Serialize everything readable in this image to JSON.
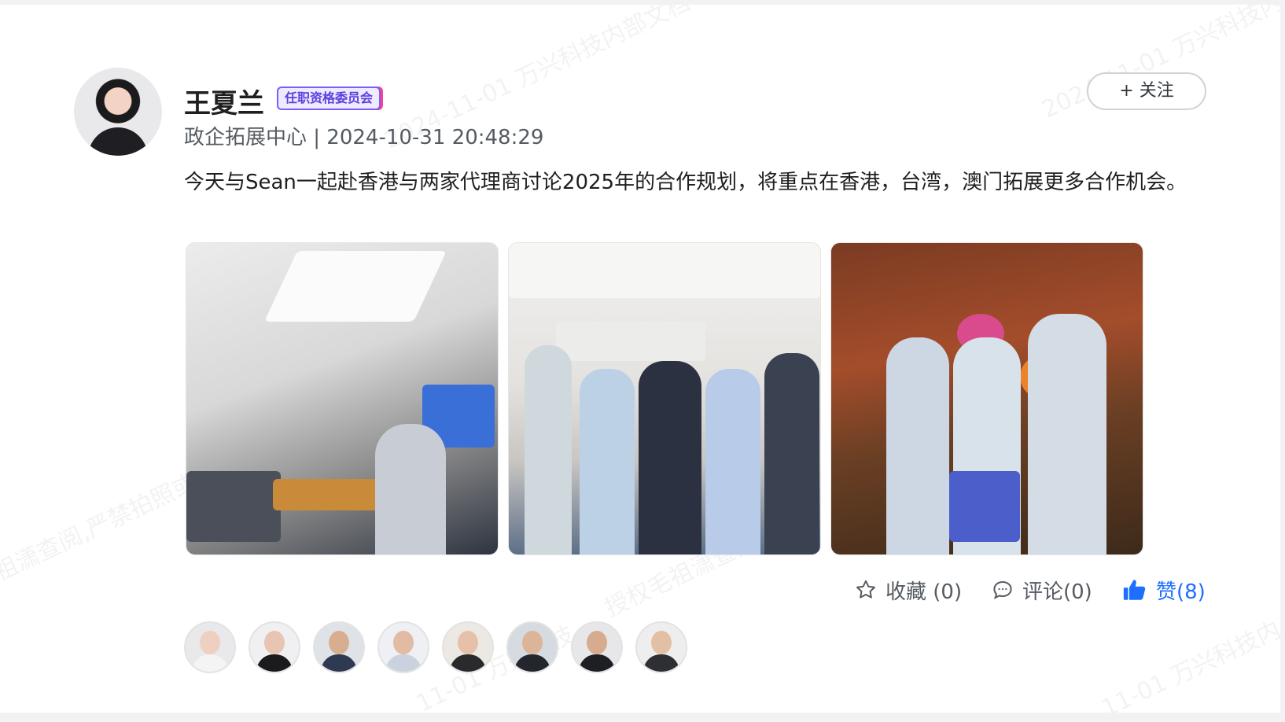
{
  "post": {
    "author_name": "王夏兰",
    "badge": "任职资格委员会",
    "meta": "政企拓展中心 | 2024-10-31 20:48:29",
    "follow_label": "+ 关注",
    "content": "今天与Sean一起赴香港与两家代理商讨论2025年的合作规划，将重点在香港，台湾，澳门拓展更多合作机会。"
  },
  "actions": {
    "favorite": {
      "label": "收藏 (0)",
      "icon": "star-icon"
    },
    "comment": {
      "label": "评论(0)",
      "icon": "comment-icon"
    },
    "like": {
      "label": "赞(8)",
      "icon": "thumbs-up-icon",
      "active": true
    }
  },
  "photos": [
    {
      "name": "meeting-room-photo"
    },
    {
      "name": "office-group-photo"
    },
    {
      "name": "flower-wall-photo"
    }
  ],
  "likers": [
    {
      "name": "liker-1"
    },
    {
      "name": "liker-2"
    },
    {
      "name": "liker-3"
    },
    {
      "name": "liker-4"
    },
    {
      "name": "liker-5"
    },
    {
      "name": "liker-6"
    },
    {
      "name": "liker-7"
    },
    {
      "name": "liker-8"
    }
  ],
  "colors": {
    "accent_blue": "#1e6fff",
    "badge_purple": "#5c3fe0",
    "muted_text": "#555b61"
  }
}
